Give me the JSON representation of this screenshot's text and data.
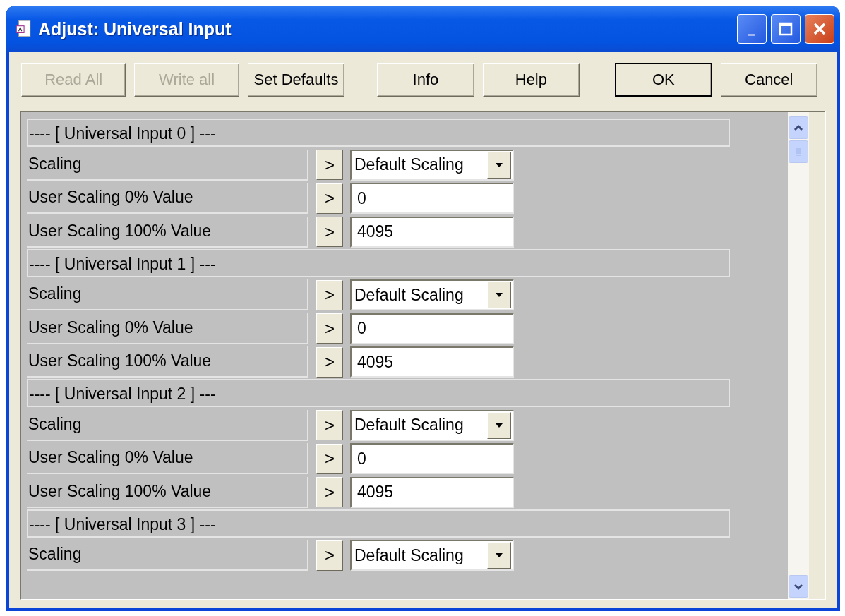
{
  "window": {
    "title": "Adjust: Universal Input"
  },
  "toolbar": [
    {
      "label": "Read All",
      "disabled": true,
      "default": false
    },
    {
      "label": "Write all",
      "disabled": true,
      "default": false
    },
    {
      "label": "Set Defaults",
      "disabled": false,
      "default": false
    },
    {
      "label": "Info",
      "disabled": false,
      "default": false
    },
    {
      "label": "Help",
      "disabled": false,
      "default": false
    },
    {
      "label": "OK",
      "disabled": false,
      "default": true
    },
    {
      "label": "Cancel",
      "disabled": false,
      "default": false
    }
  ],
  "sections": [
    {
      "title": "---- [ Universal Input 0 ] ---",
      "params": [
        {
          "kind": "dropdown",
          "label": "Scaling",
          "button": ">",
          "value": "Default Scaling"
        },
        {
          "kind": "field",
          "label": "User Scaling 0% Value",
          "button": ">",
          "value": "0"
        },
        {
          "kind": "field",
          "label": "User Scaling 100% Value",
          "button": ">",
          "value": "4095"
        }
      ]
    },
    {
      "title": "---- [ Universal Input 1 ] ---",
      "params": [
        {
          "kind": "dropdown",
          "label": "Scaling",
          "button": ">",
          "value": "Default Scaling"
        },
        {
          "kind": "field",
          "label": "User Scaling 0% Value",
          "button": ">",
          "value": "0"
        },
        {
          "kind": "field",
          "label": "User Scaling 100% Value",
          "button": ">",
          "value": "4095"
        }
      ]
    },
    {
      "title": "---- [ Universal Input 2 ] ---",
      "params": [
        {
          "kind": "dropdown",
          "label": "Scaling",
          "button": ">",
          "value": "Default Scaling"
        },
        {
          "kind": "field",
          "label": "User Scaling 0% Value",
          "button": ">",
          "value": "0"
        },
        {
          "kind": "field",
          "label": "User Scaling 100% Value",
          "button": ">",
          "value": "4095"
        }
      ]
    },
    {
      "title": "---- [ Universal Input 3 ] ---",
      "params": [
        {
          "kind": "dropdown",
          "label": "Scaling",
          "button": ">",
          "value": "Default Scaling"
        }
      ]
    }
  ]
}
